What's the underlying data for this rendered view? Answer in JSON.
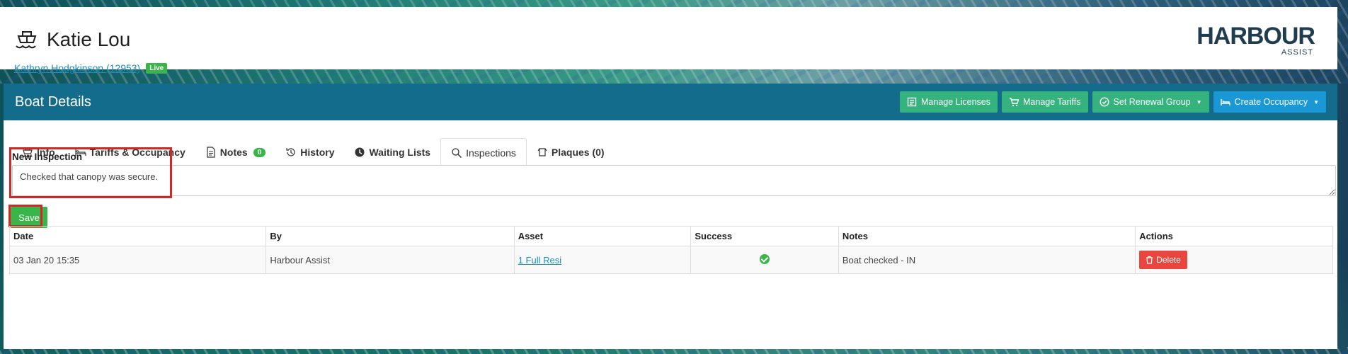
{
  "header": {
    "boat_name": "Katie Lou",
    "owner_link": "Kathryn Hodgkinson (12953)",
    "status_badge": "Live",
    "logo_brand": "HARBOUR",
    "logo_sub": "ASSIST"
  },
  "panel": {
    "title": "Boat Details",
    "buttons": [
      {
        "label": "Manage Licenses",
        "icon": "licenses-icon"
      },
      {
        "label": "Manage Tariffs",
        "icon": "cart-icon"
      },
      {
        "label": "Set Renewal Group",
        "icon": "check-circle-icon"
      },
      {
        "label": "Create Occupancy",
        "icon": "bed-icon"
      }
    ]
  },
  "tabs": [
    {
      "label": "Info",
      "icon": "boat-icon"
    },
    {
      "label": "Tariffs & Occupancy",
      "icon": "bed-icon"
    },
    {
      "label": "Notes",
      "icon": "document-icon",
      "count": "0"
    },
    {
      "label": "History",
      "icon": "history-icon"
    },
    {
      "label": "Waiting Lists",
      "icon": "clock-icon"
    },
    {
      "label": "Inspections",
      "icon": "search-icon",
      "active": true
    },
    {
      "label": "Plaques (0)",
      "icon": "plaque-icon"
    }
  ],
  "inspection_form": {
    "label": "New Inspection",
    "value": "Checked that canopy was secure.",
    "save_label": "Save"
  },
  "table": {
    "headers": [
      "Date",
      "By",
      "Asset",
      "Success",
      "Notes",
      "Actions"
    ],
    "rows": [
      {
        "date": "03 Jan 20 15:35",
        "by": "Harbour Assist",
        "asset": "1 Full Resi",
        "success": true,
        "notes": "Boat checked - IN",
        "action_label": "Delete"
      }
    ]
  },
  "colors": {
    "panel_header": "#136c8c",
    "green_button": "#34b37d",
    "blue_button": "#1a98d5",
    "success": "#3ab54a",
    "danger": "#e8463f",
    "highlight": "#d32626"
  }
}
